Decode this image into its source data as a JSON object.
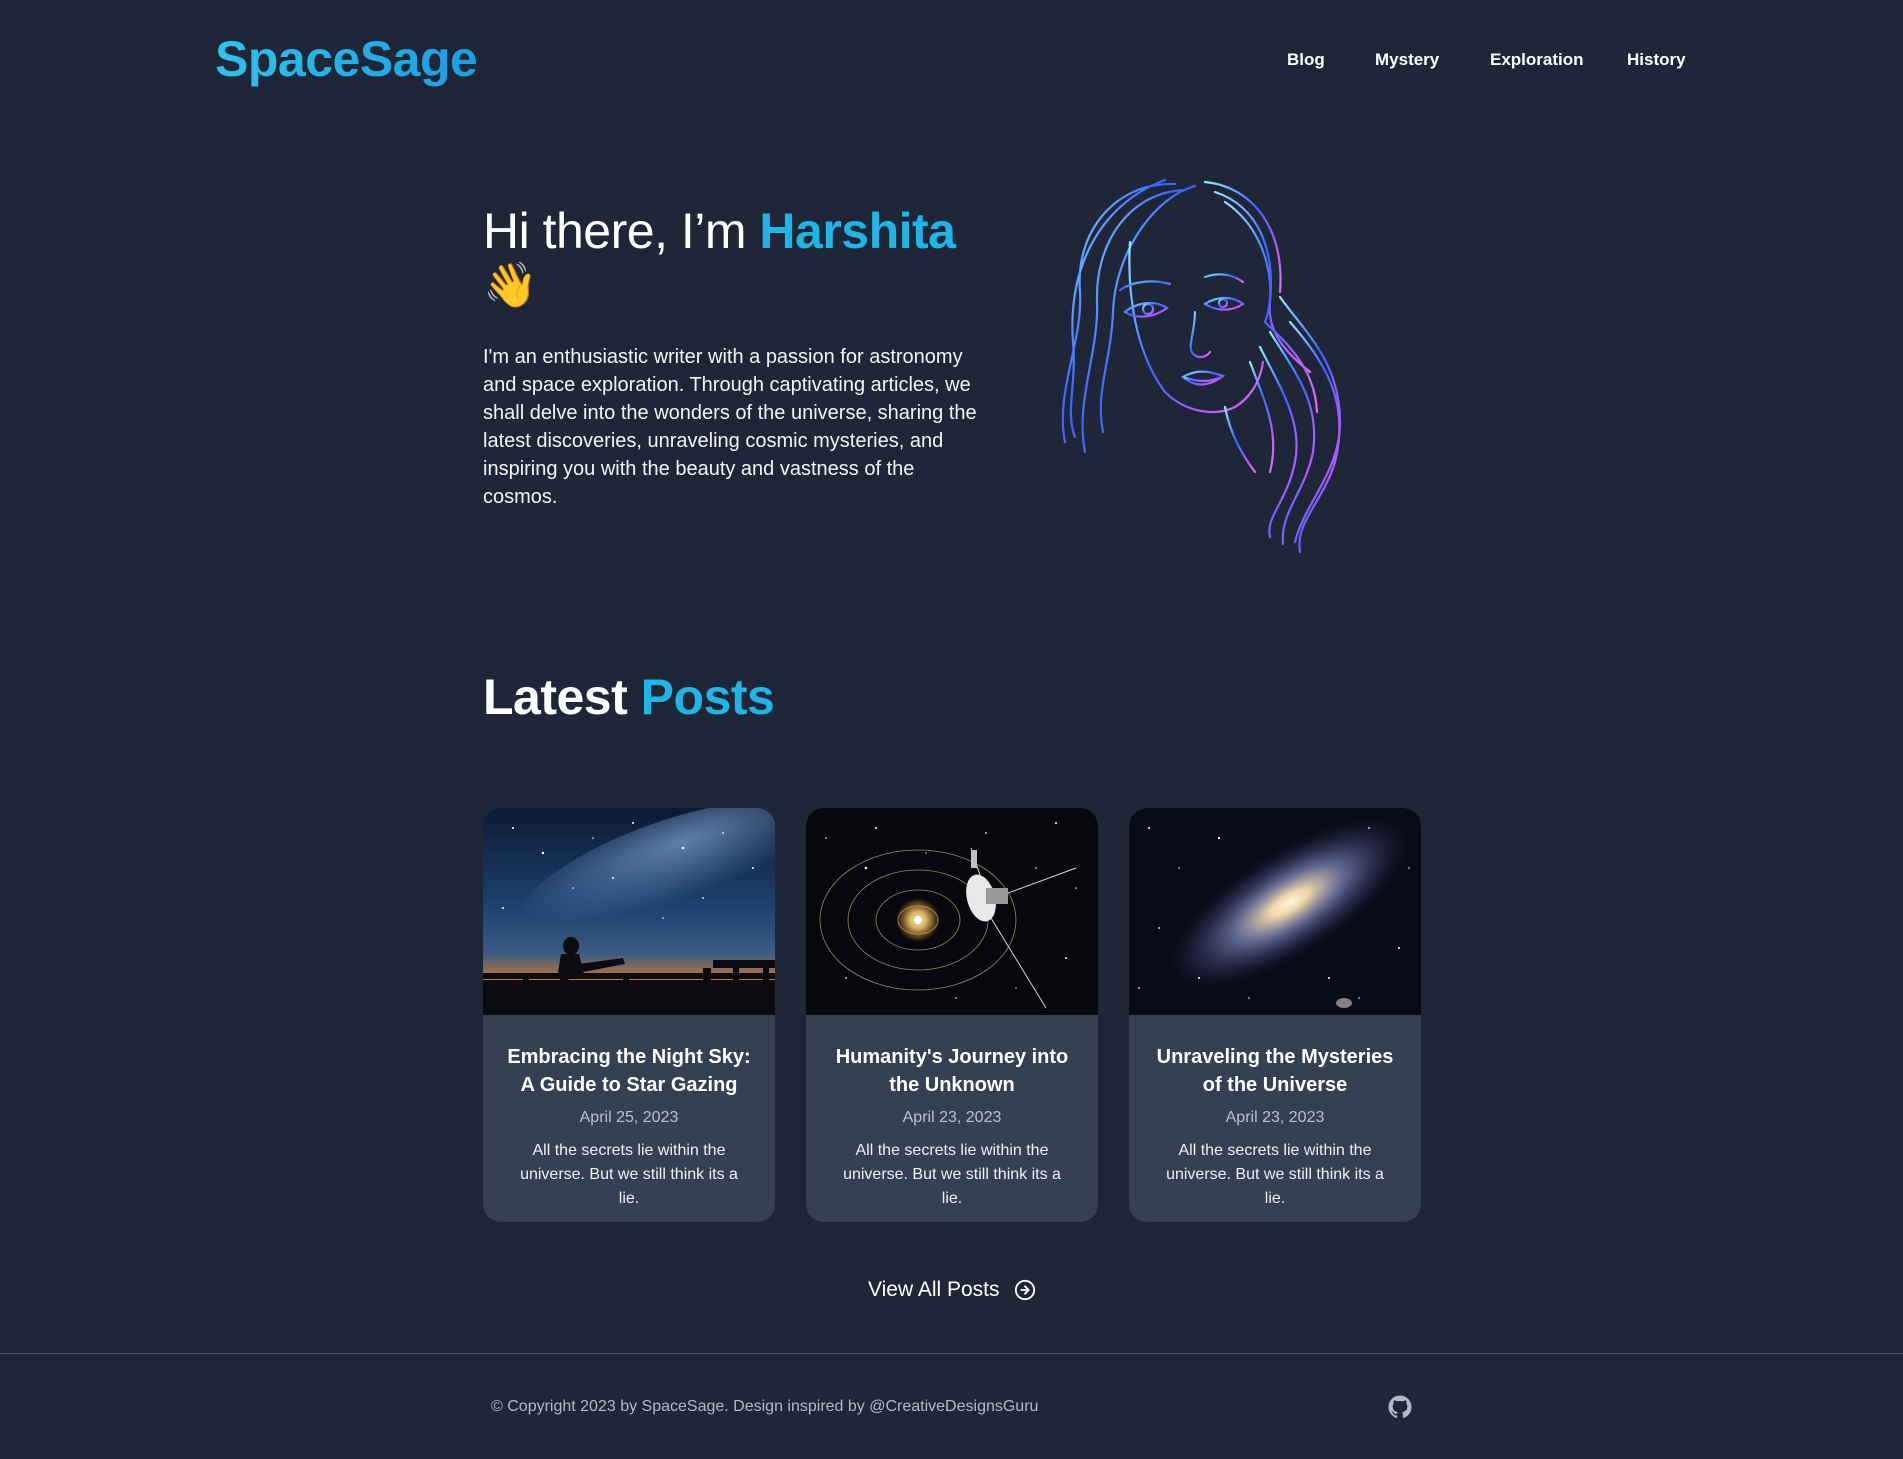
{
  "brand": {
    "logo": "SpaceSage",
    "accent_color": "#1fb6e6",
    "background_color": "#1f2637",
    "card_color": "#354053"
  },
  "nav": {
    "items": [
      {
        "label": "Blog"
      },
      {
        "label": "Mystery"
      },
      {
        "label": "Exploration"
      },
      {
        "label": "History"
      }
    ]
  },
  "hero": {
    "greeting": "Hi there, I’m ",
    "name": "Harshita",
    "wave_emoji": "👋",
    "description": "I'm an enthusiastic writer with a passion for astronomy and space exploration. Through captivating articles, we shall delve into the wonders of the universe, sharing the latest discoveries, unraveling cosmic mysteries, and inspiring you with the beauty and vastness of the cosmos.",
    "portrait_icon": "woman-line-art-portrait"
  },
  "latest": {
    "title_part1": "Latest ",
    "title_part2": "Posts",
    "posts": [
      {
        "title": "Embracing the Night Sky: A Guide to Star Gazing",
        "date": "April 25, 2023",
        "excerpt": "All the secrets lie within the universe. But we still think its a lie.",
        "image": "stargazer-silhouette-sunset"
      },
      {
        "title": "Humanity's Journey into the Unknown",
        "date": "April 23, 2023",
        "excerpt": "All the secrets lie within the universe. But we still think its a lie.",
        "image": "voyager-probe-solar-system"
      },
      {
        "title": "Unraveling the Mysteries of the Universe",
        "date": "April 23, 2023",
        "excerpt": "All the secrets lie within the universe. But we still think its a lie.",
        "image": "spiral-galaxy"
      }
    ],
    "view_all_label": "View All Posts",
    "view_all_icon": "circle-arrow-right-icon"
  },
  "footer": {
    "copyright": "© Copyright 2023 by SpaceSage. Design inspired by @CreativeDesignsGuru",
    "github_icon": "github-icon"
  }
}
